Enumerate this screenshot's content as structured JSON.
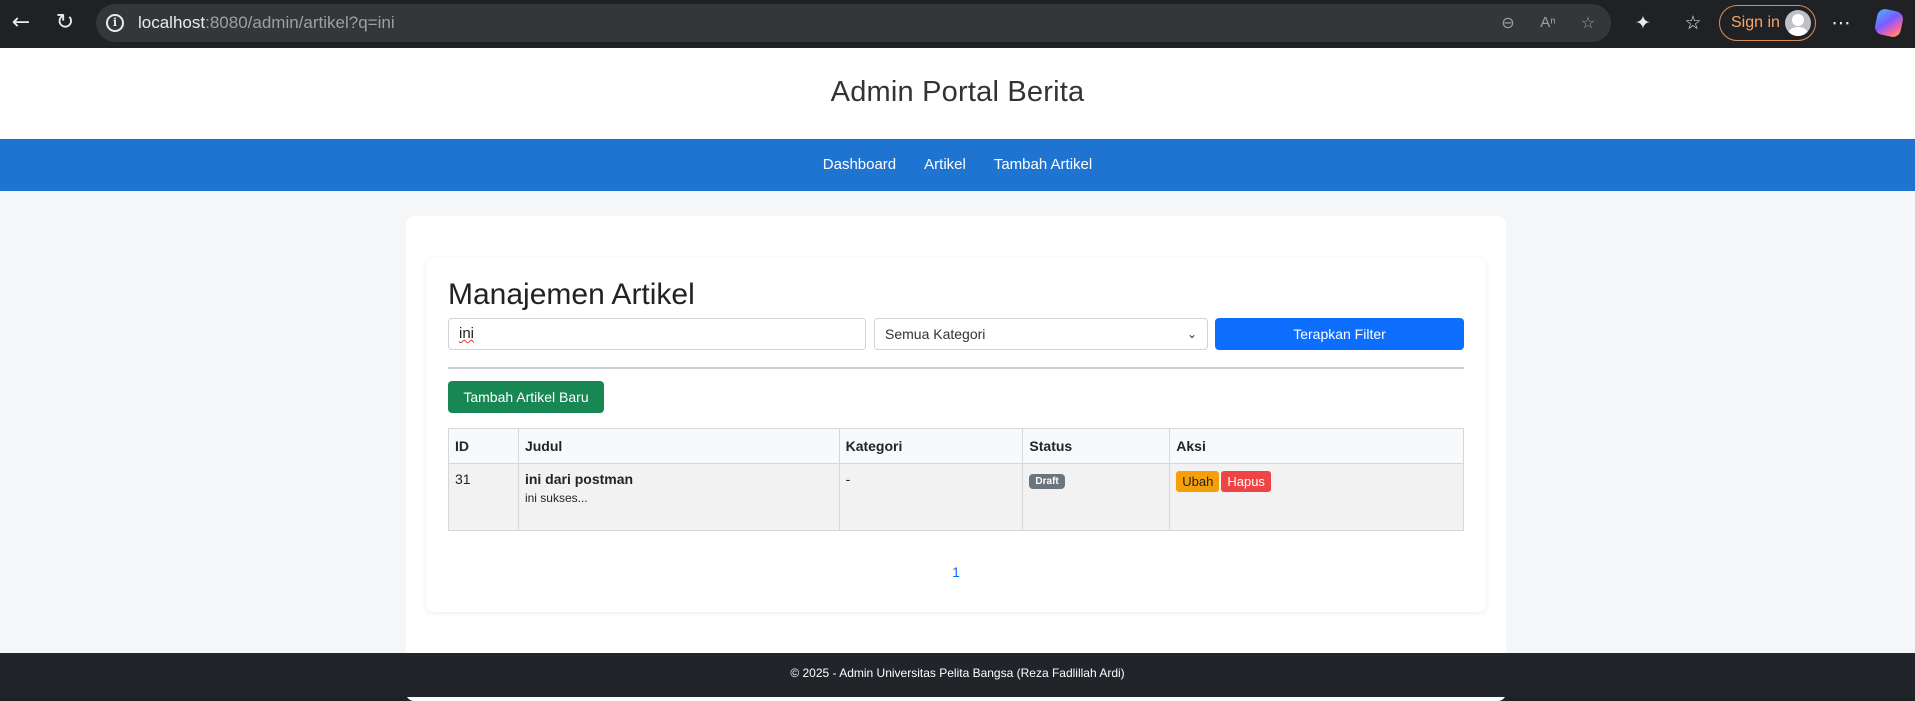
{
  "browser": {
    "url_host": "localhost",
    "url_rest": ":8080/admin/artikel?q=ini",
    "signin_label": "Sign in"
  },
  "header": {
    "title": "Admin Portal Berita"
  },
  "nav": {
    "items": [
      "Dashboard",
      "Artikel",
      "Tambah Artikel"
    ]
  },
  "main": {
    "title": "Manajemen Artikel",
    "search_value": "ini",
    "category_selected": "Semua Kategori",
    "apply_label": "Terapkan Filter",
    "add_label": "Tambah Artikel Baru",
    "table": {
      "headers": [
        "ID",
        "Judul",
        "Kategori",
        "Status",
        "Aksi"
      ],
      "rows": [
        {
          "id": "31",
          "title": "ini dari postman",
          "excerpt": "ini sukses...",
          "category": "-",
          "status": "Draft",
          "edit_label": "Ubah",
          "delete_label": "Hapus"
        }
      ]
    },
    "pagination": [
      "1"
    ]
  },
  "footer": {
    "text": "© 2025 - Admin Universitas Pelita Bangsa (Reza Fadlillah Ardi)"
  },
  "colors": {
    "nav_bg": "#1f74d1",
    "primary": "#0d6efd",
    "success": "#198754",
    "warning": "#f59f0b",
    "danger": "#ef4444",
    "badge": "#6c757d",
    "footer_bg": "#212529"
  }
}
